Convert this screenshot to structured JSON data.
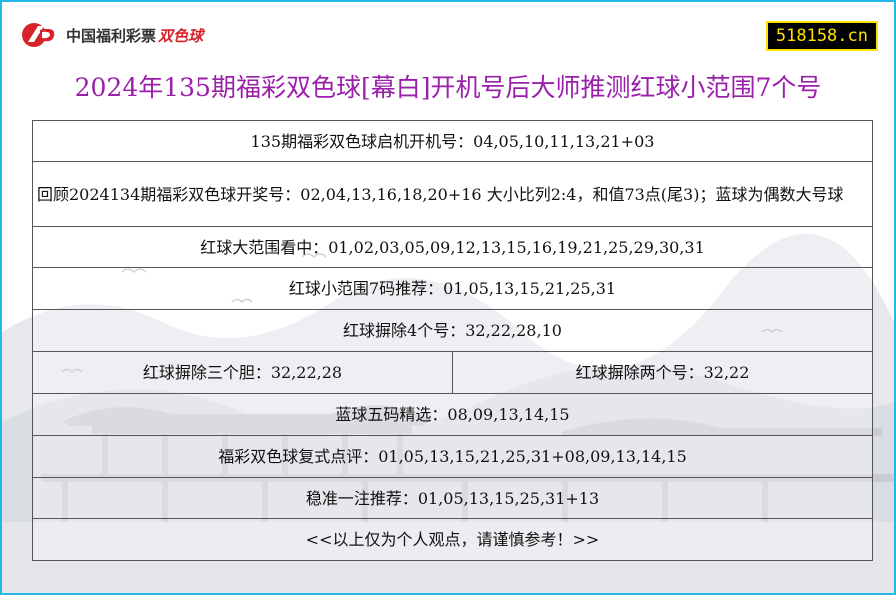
{
  "logo": {
    "brand": "中国福利彩票",
    "game": "双色球"
  },
  "site_badge": "518158.cn",
  "title": "2024年135期福彩双色球[幕白]开机号后大师推测红球小范围7个号",
  "rows": {
    "machine_number": "135期福彩双色球启机开机号：04,05,10,11,13,21+03",
    "review": "回顾2024134期福彩双色球开奖号：02,04,13,16,18,20+16 大小比列2:4，和值73点(尾3)；蓝球为偶数大号球",
    "red_large_range": "红球大范围看中：01,02,03,05,09,12,13,15,16,19,21,25,29,30,31",
    "red_small_range": "红球小范围7码推荐：01,05,13,15,21,25,31",
    "red_kill_four": "红球摒除4个号：32,22,28,10",
    "red_kill_three": "红球摒除三个胆：32,22,28",
    "red_kill_two": "红球摒除两个号：32,22",
    "blue_five": "蓝球五码精选：08,09,13,14,15",
    "compound": "福彩双色球复式点评：01,05,13,15,21,25,31+08,09,13,14,15",
    "single_pick": "稳准一注推荐：01,05,13,15,25,31+13",
    "disclaimer": "<<以上仅为个人观点，请谨慎参考！>>"
  },
  "colors": {
    "title": "#9a1faa",
    "border": "#22b8e8",
    "badge_bg": "#000000",
    "badge_text": "#ffe000",
    "logo_red": "#d8222a"
  }
}
